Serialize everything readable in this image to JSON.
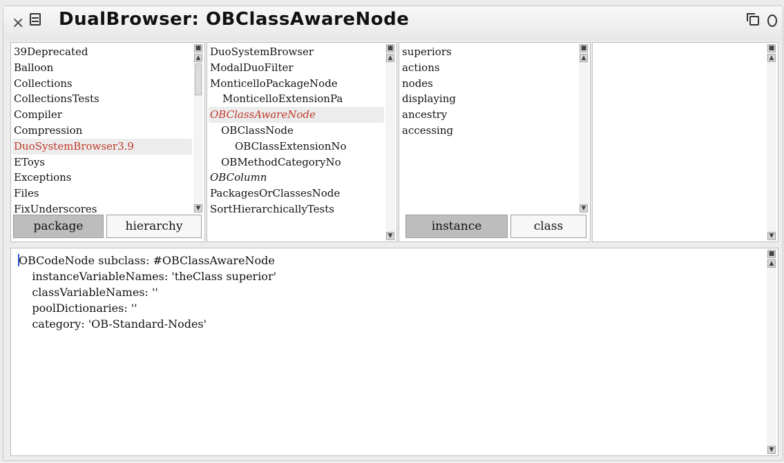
{
  "window": {
    "title": "DualBrowser: OBClassAwareNode",
    "close_glyph": "×"
  },
  "packages": {
    "items": [
      "39Deprecated",
      "Balloon",
      "Collections",
      "CollectionsTests",
      "Compiler",
      "Compression",
      "DuoSystemBrowser3.9",
      "EToys",
      "Exceptions",
      "Files",
      "FixUnderscores"
    ],
    "buttons": {
      "package": "package",
      "hierarchy": "hierarchy"
    }
  },
  "classes": {
    "items": [
      "DuoSystemBrowser",
      "ModalDuoFilter",
      "MonticelloPackageNode",
      "MonticelloExtensionPa",
      "OBClassAwareNode",
      "OBClassNode",
      "OBClassExtensionNo",
      "OBMethodCategoryNo",
      "OBColumn",
      "PackagesOrClassesNode",
      "SortHierarchicallyTests"
    ]
  },
  "protocols": {
    "items": [
      "superiors",
      "actions",
      "nodes",
      "displaying",
      "ancestry",
      "accessing"
    ],
    "buttons": {
      "instance": "instance",
      "class": "class"
    }
  },
  "code": {
    "lines": [
      "OBCodeNode subclass: #OBClassAwareNode",
      "    instanceVariableNames: 'theClass superior'",
      "    classVariableNames: ''",
      "    poolDictionaries: ''",
      "    category: 'OB-Standard-Nodes'"
    ]
  },
  "colors": {
    "selection_text": "#c0392b",
    "active_button": "#bdbdbd",
    "caret": "#2f5bd3"
  }
}
